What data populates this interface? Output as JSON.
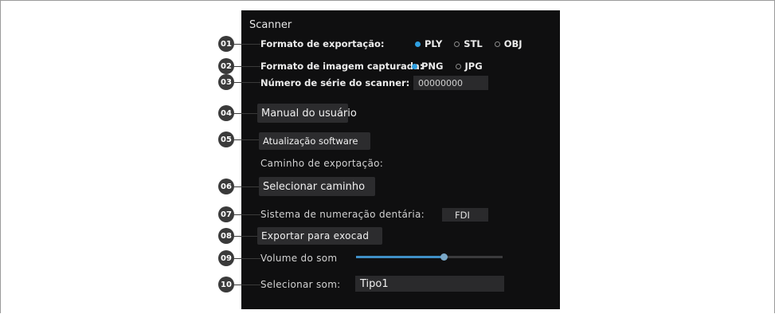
{
  "panel": {
    "title": "Scanner"
  },
  "callouts": [
    "01",
    "02",
    "03",
    "04",
    "05",
    "06",
    "07",
    "08",
    "09",
    "10"
  ],
  "export_format": {
    "label": "Formato de exportação:",
    "options": [
      "PLY",
      "STL",
      "OBJ"
    ],
    "selected": "PLY"
  },
  "image_format": {
    "label": "Formato de imagem capturada:",
    "options": [
      "PNG",
      "JPG"
    ],
    "selected": "PNG"
  },
  "serial": {
    "label": "Número de série do scanner:",
    "value": "00000000"
  },
  "manual_button": "Manual do usuário",
  "update_button": "Atualização software",
  "export_path_label": "Caminho de exportação:",
  "select_path_button": "Selecionar caminho",
  "tooth_numbering": {
    "label": "Sistema de numeração dentária:",
    "value": "FDI"
  },
  "exocad_button": "Exportar para exocad",
  "volume": {
    "label": "Volume do som",
    "level": 0.6
  },
  "sound": {
    "label": "Selecionar som:",
    "value": "Tipo1"
  },
  "colors": {
    "accent": "#2f9fe0",
    "panel": "#0f0f10",
    "callout": "#3a3a3a"
  }
}
